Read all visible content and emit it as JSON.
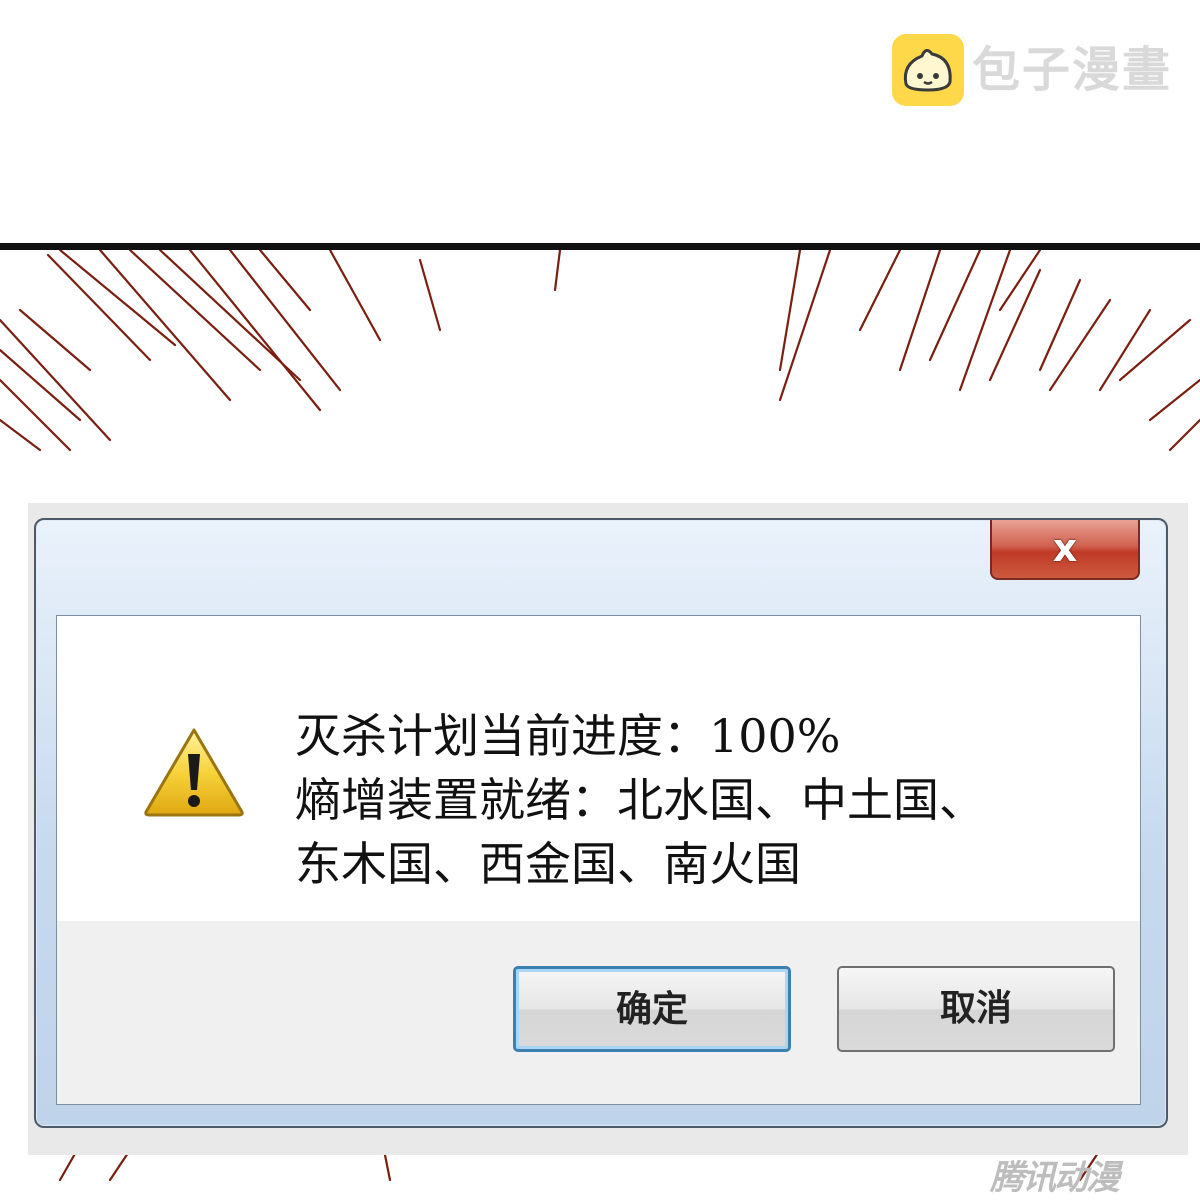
{
  "watermark": {
    "brand_text": "包子漫畫",
    "bottom_text": "腾讯动漫"
  },
  "dialog": {
    "close_label": "x",
    "icon": "warning-triangle-icon",
    "message_lines": [
      "灭杀计划当前进度：100%",
      "熵增装置就绪：北水国、中土国、",
      "东木国、西金国、南火国"
    ],
    "ok_label": "确定",
    "cancel_label": "取消"
  },
  "colors": {
    "speedlines": "#7a1f10",
    "panel_border": "#111111",
    "titlebar": "#c6d9ef",
    "close_button": "#c8452f",
    "ok_border": "#3c7fb1",
    "brand_logo": "#ffd84a"
  }
}
